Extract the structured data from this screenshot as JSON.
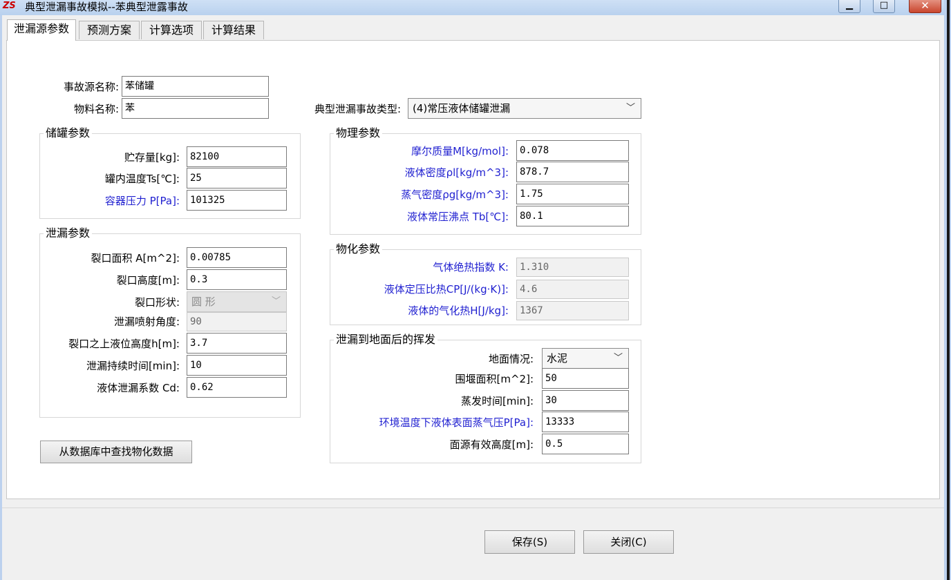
{
  "window": {
    "title": "典型泄漏事故模拟--苯典型泄露事故",
    "icon": "app-logo-icon",
    "app_icon_text": "ZS",
    "minimize_glyph": "▁",
    "maximize_glyph": "□",
    "close_glyph": "✕"
  },
  "tabs": [
    "泄漏源参数",
    "预测方案",
    "计算选项",
    "计算结果"
  ],
  "top": {
    "source_name_label": "事故源名称:",
    "source_name_value": "苯储罐",
    "material_name_label": "物料名称:",
    "material_name_value": "苯",
    "accident_type_label": "典型泄漏事故类型:",
    "accident_type_value": "(4)常压液体储罐泄漏"
  },
  "tank": {
    "title": "储罐参数",
    "fields": [
      {
        "label": "贮存量[kg]:",
        "value": "82100",
        "blue": false
      },
      {
        "label": "罐内温度Ts[℃]:",
        "value": "25",
        "blue": false
      },
      {
        "label": "容器压力 P[Pa]:",
        "value": "101325",
        "blue": true
      }
    ]
  },
  "leak": {
    "title": "泄漏参数",
    "crack_area_label": "裂口面积 A[m^2]:",
    "crack_area_value": "0.00785",
    "crack_height_label": "裂口高度[m]:",
    "crack_height_value": "0.3",
    "crack_shape_label": "裂口形状:",
    "crack_shape_value": "圆  形",
    "spray_angle_label": "泄漏喷射角度:",
    "spray_angle_value": "90",
    "liquid_level_label": "裂口之上液位高度h[m]:",
    "liquid_level_value": "3.7",
    "duration_label": "泄漏持续时间[min]:",
    "duration_value": "10",
    "coefficient_label": "液体泄漏系数  Cd:",
    "coefficient_value": "0.62"
  },
  "physical": {
    "title": "物理参数",
    "fields": [
      {
        "label": "摩尔质量M[kg/mol]:",
        "value": "0.078"
      },
      {
        "label": "液体密度ρl[kg/m^3]:",
        "value": "878.7"
      },
      {
        "label": "蒸气密度ρg[kg/m^3]:",
        "value": "1.75"
      },
      {
        "label": "液体常压沸点 Tb[℃]:",
        "value": "80.1"
      }
    ]
  },
  "physchem": {
    "title": "物化参数",
    "fields": [
      {
        "label": "气体绝热指数  K:",
        "value": "1.310"
      },
      {
        "label": "液体定压比热CP[J/(kg·K)]:",
        "value": "4.6"
      },
      {
        "label": "液体的气化热H[J/kg]:",
        "value": "1367"
      }
    ]
  },
  "evap": {
    "title": "泄漏到地面后的挥发",
    "ground_label": "地面情况:",
    "ground_value": "水泥",
    "fields": [
      {
        "label": "围堰面积[m^2]:",
        "value": "50",
        "blue": false
      },
      {
        "label": "蒸发时间[min]:",
        "value": "30",
        "blue": false
      },
      {
        "label": "环境温度下液体表面蒸气压P[Pa]:",
        "value": "13333",
        "blue": true
      },
      {
        "label": "面源有效高度[m]:",
        "value": "0.5",
        "blue": false
      }
    ]
  },
  "buttons": {
    "lookup": "从数据库中查找物化数据",
    "save": "保存(S)",
    "close": "关闭(C)"
  },
  "colors": {
    "blue_label": "#1f1fd0",
    "titlebar": "#c6dbf4",
    "close_button": "#c9452d"
  }
}
